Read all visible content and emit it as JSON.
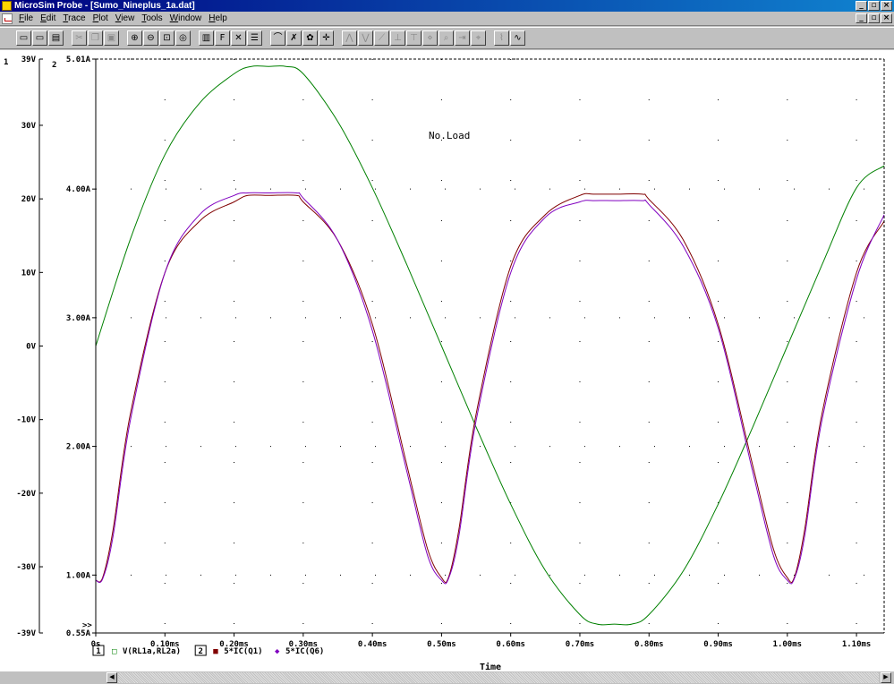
{
  "window": {
    "title": "MicroSim Probe - [Sumo_Nineplus_1a.dat]",
    "buttons": [
      "_",
      "▫",
      "×"
    ]
  },
  "menu": {
    "items": [
      {
        "u": "F",
        "rest": "ile"
      },
      {
        "u": "E",
        "rest": "dit"
      },
      {
        "u": "T",
        "rest": "race"
      },
      {
        "u": "P",
        "rest": "lot"
      },
      {
        "u": "V",
        "rest": "iew"
      },
      {
        "u": "T",
        "pre": "",
        "rest": "ools"
      },
      {
        "u": "W",
        "rest": "indow"
      },
      {
        "u": "H",
        "rest": "elp"
      }
    ],
    "doc_buttons": [
      "_",
      "▫",
      "×"
    ]
  },
  "toolbar": {
    "icons": [
      {
        "name": "open-icon",
        "glyph": "▭",
        "enabled": true
      },
      {
        "name": "append-icon",
        "glyph": "▭",
        "enabled": true
      },
      {
        "name": "print-icon",
        "glyph": "▤",
        "enabled": true
      },
      {
        "sep": true
      },
      {
        "name": "cut-icon",
        "glyph": "✂",
        "enabled": false
      },
      {
        "name": "copy-icon",
        "glyph": "❐",
        "enabled": false
      },
      {
        "name": "paste-icon",
        "glyph": "▣",
        "enabled": false
      },
      {
        "sep": true
      },
      {
        "name": "zoom-in-icon",
        "glyph": "⊕",
        "enabled": true
      },
      {
        "name": "zoom-out-icon",
        "glyph": "⊖",
        "enabled": true
      },
      {
        "name": "zoom-area-icon",
        "glyph": "⊡",
        "enabled": true
      },
      {
        "name": "zoom-fit-icon",
        "glyph": "◎",
        "enabled": true
      },
      {
        "sep": true
      },
      {
        "name": "log-x-icon",
        "glyph": "▥",
        "enabled": true
      },
      {
        "name": "fourier-icon",
        "glyph": "F",
        "enabled": true
      },
      {
        "name": "performance-icon",
        "glyph": "✕",
        "enabled": true
      },
      {
        "name": "eval-icon",
        "glyph": "☰",
        "enabled": true
      },
      {
        "sep": true
      },
      {
        "name": "add-trace-icon",
        "glyph": "⌒",
        "enabled": true
      },
      {
        "name": "remove-trace-icon",
        "glyph": "✗",
        "enabled": true
      },
      {
        "name": "color-icon",
        "glyph": "✿",
        "enabled": true
      },
      {
        "name": "cursor-icon",
        "glyph": "✛",
        "enabled": true
      },
      {
        "sep": true
      },
      {
        "name": "cursor-peak-icon",
        "glyph": "⋀",
        "enabled": false
      },
      {
        "name": "cursor-trough-icon",
        "glyph": "⋁",
        "enabled": false
      },
      {
        "name": "cursor-slope-icon",
        "glyph": "⟋",
        "enabled": false
      },
      {
        "name": "cursor-min-icon",
        "glyph": "⊥",
        "enabled": false
      },
      {
        "name": "cursor-max-icon",
        "glyph": "⊤",
        "enabled": false
      },
      {
        "name": "cursor-point-icon",
        "glyph": "⋄",
        "enabled": false
      },
      {
        "name": "cursor-search-icon",
        "glyph": "⌕",
        "enabled": false
      },
      {
        "name": "cursor-next-icon",
        "glyph": "⇥",
        "enabled": false
      },
      {
        "name": "cursor-mark-icon",
        "glyph": "⌖",
        "enabled": false
      },
      {
        "sep": true
      },
      {
        "name": "mark-label-icon",
        "glyph": "⌇",
        "enabled": false
      },
      {
        "name": "text-label-icon",
        "glyph": "∿",
        "enabled": true
      }
    ]
  },
  "chart_data": {
    "type": "line",
    "annotation": "No.Load",
    "xlabel": "Time",
    "xlim": [
      0,
      1.14
    ],
    "xunit": "ms",
    "xticks": [
      0,
      0.1,
      0.2,
      0.3,
      0.4,
      0.5,
      0.6,
      0.7,
      0.8,
      0.9,
      1.0,
      1.1
    ],
    "xtick_labels": [
      "0s",
      "0.10ms",
      "0.20ms",
      "0.30ms",
      "0.40ms",
      "0.50ms",
      "0.60ms",
      "0.70ms",
      "0.80ms",
      "0.90ms",
      "1.00ms",
      "1.10ms"
    ],
    "axes": [
      {
        "id": "1",
        "unit": "V",
        "ylim": [
          -39,
          39
        ],
        "ticks": [
          -39,
          -30,
          -20,
          -10,
          0,
          10,
          20,
          30,
          39
        ],
        "tick_labels": [
          "-39V",
          "-30V",
          "-20V",
          "-10V",
          "0V",
          "10V",
          "20V",
          "30V",
          "39V"
        ]
      },
      {
        "id": "2",
        "unit": "A",
        "ylim": [
          0.55,
          5.01
        ],
        "ticks": [
          0.55,
          1.0,
          2.0,
          3.0,
          4.0,
          5.01
        ],
        "tick_labels": [
          "0.55A",
          "1.00A",
          "2.00A",
          "3.00A",
          "4.00A",
          "5.01A"
        ]
      }
    ],
    "legend_axis1": "1",
    "legend_axis2": "2",
    "overflow_marker": ">>",
    "series": [
      {
        "name": "V(RL1a,RL2a)",
        "axis": "1",
        "marker": "□",
        "color": "#008000",
        "x": [
          0,
          0.05,
          0.1,
          0.15,
          0.2,
          0.225,
          0.25,
          0.275,
          0.3,
          0.35,
          0.4,
          0.45,
          0.5,
          0.55,
          0.6,
          0.65,
          0.7,
          0.725,
          0.75,
          0.775,
          0.8,
          0.85,
          0.9,
          0.95,
          1.0,
          1.05,
          1.1,
          1.14
        ],
        "values": [
          0,
          14.5,
          26.0,
          33.0,
          37.0,
          38.0,
          38.0,
          38.0,
          37.0,
          30.5,
          21.5,
          11.0,
          0,
          -11.0,
          -21.5,
          -30.5,
          -36.5,
          -37.8,
          -37.8,
          -37.8,
          -36.5,
          -30.5,
          -21.5,
          -11.0,
          0,
          11.0,
          21.5,
          24.5
        ]
      },
      {
        "name": "5*IC(Q1)",
        "axis": "2",
        "marker": "■",
        "color": "#800000",
        "x": [
          0,
          0.01,
          0.025,
          0.05,
          0.1,
          0.15,
          0.2,
          0.22,
          0.25,
          0.29,
          0.3,
          0.35,
          0.4,
          0.45,
          0.48,
          0.5,
          0.51,
          0.525,
          0.55,
          0.6,
          0.65,
          0.7,
          0.72,
          0.75,
          0.79,
          0.8,
          0.85,
          0.9,
          0.95,
          0.98,
          1.0,
          1.01,
          1.025,
          1.05,
          1.1,
          1.14
        ],
        "values": [
          0.96,
          0.98,
          1.35,
          2.25,
          3.35,
          3.75,
          3.9,
          3.95,
          3.95,
          3.95,
          3.9,
          3.6,
          2.95,
          1.85,
          1.2,
          0.98,
          0.98,
          1.35,
          2.25,
          3.4,
          3.8,
          3.95,
          3.96,
          3.96,
          3.96,
          3.92,
          3.6,
          2.95,
          1.85,
          1.2,
          0.98,
          0.98,
          1.35,
          2.25,
          3.35,
          3.75
        ]
      },
      {
        "name": "5*IC(Q6)",
        "axis": "2",
        "marker": "◆",
        "color": "#8000c0",
        "x": [
          0,
          0.01,
          0.025,
          0.05,
          0.1,
          0.15,
          0.2,
          0.22,
          0.25,
          0.29,
          0.3,
          0.35,
          0.4,
          0.45,
          0.48,
          0.5,
          0.51,
          0.525,
          0.55,
          0.6,
          0.65,
          0.7,
          0.72,
          0.75,
          0.79,
          0.8,
          0.85,
          0.9,
          0.95,
          0.98,
          1.0,
          1.01,
          1.025,
          1.05,
          1.1,
          1.14
        ],
        "values": [
          0.96,
          0.97,
          1.3,
          2.2,
          3.35,
          3.8,
          3.95,
          3.97,
          3.97,
          3.97,
          3.93,
          3.6,
          2.9,
          1.8,
          1.15,
          0.96,
          0.97,
          1.3,
          2.2,
          3.35,
          3.78,
          3.9,
          3.91,
          3.91,
          3.91,
          3.88,
          3.55,
          2.92,
          1.8,
          1.15,
          0.96,
          0.97,
          1.3,
          2.2,
          3.3,
          3.8
        ]
      }
    ]
  }
}
